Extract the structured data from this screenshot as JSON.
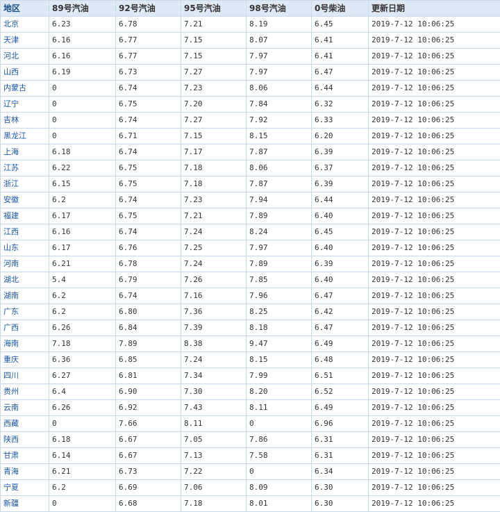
{
  "table": {
    "headers": [
      "地区",
      "89号汽油",
      "92号汽油",
      "95号汽油",
      "98号汽油",
      "0号柴油",
      "更新日期"
    ],
    "rows": [
      [
        "北京",
        "6.23",
        "6.78",
        "7.21",
        "8.19",
        "6.45",
        "2019-7-12  10:06:25"
      ],
      [
        "天津",
        "6.16",
        "6.77",
        "7.15",
        "8.07",
        "6.41",
        "2019-7-12  10:06:25"
      ],
      [
        "河北",
        "6.16",
        "6.77",
        "7.15",
        "7.97",
        "6.41",
        "2019-7-12  10:06:25"
      ],
      [
        "山西",
        "6.19",
        "6.73",
        "7.27",
        "7.97",
        "6.47",
        "2019-7-12  10:06:25"
      ],
      [
        "内蒙古",
        "0",
        "6.74",
        "7.23",
        "8.06",
        "6.44",
        "2019-7-12  10:06:25"
      ],
      [
        "辽宁",
        "0",
        "6.75",
        "7.20",
        "7.84",
        "6.32",
        "2019-7-12  10:06:25"
      ],
      [
        "吉林",
        "0",
        "6.74",
        "7.27",
        "7.92",
        "6.33",
        "2019-7-12  10:06:25"
      ],
      [
        "黑龙江",
        "0",
        "6.71",
        "7.15",
        "8.15",
        "6.20",
        "2019-7-12  10:06:25"
      ],
      [
        "上海",
        "6.18",
        "6.74",
        "7.17",
        "7.87",
        "6.39",
        "2019-7-12  10:06:25"
      ],
      [
        "江苏",
        "6.22",
        "6.75",
        "7.18",
        "8.06",
        "6.37",
        "2019-7-12  10:06:25"
      ],
      [
        "浙江",
        "6.15",
        "6.75",
        "7.18",
        "7.87",
        "6.39",
        "2019-7-12  10:06:25"
      ],
      [
        "安徽",
        "6.2",
        "6.74",
        "7.23",
        "7.94",
        "6.44",
        "2019-7-12  10:06:25"
      ],
      [
        "福建",
        "6.17",
        "6.75",
        "7.21",
        "7.89",
        "6.40",
        "2019-7-12  10:06:25"
      ],
      [
        "江西",
        "6.16",
        "6.74",
        "7.24",
        "8.24",
        "6.45",
        "2019-7-12  10:06:25"
      ],
      [
        "山东",
        "6.17",
        "6.76",
        "7.25",
        "7.97",
        "6.40",
        "2019-7-12  10:06:25"
      ],
      [
        "河南",
        "6.21",
        "6.78",
        "7.24",
        "7.89",
        "6.39",
        "2019-7-12  10:06:25"
      ],
      [
        "湖北",
        "5.4",
        "6.79",
        "7.26",
        "7.85",
        "6.40",
        "2019-7-12  10:06:25"
      ],
      [
        "湖南",
        "6.2",
        "6.74",
        "7.16",
        "7.96",
        "6.47",
        "2019-7-12  10:06:25"
      ],
      [
        "广东",
        "6.2",
        "6.80",
        "7.36",
        "8.25",
        "6.42",
        "2019-7-12  10:06:25"
      ],
      [
        "广西",
        "6.26",
        "6.84",
        "7.39",
        "8.18",
        "6.47",
        "2019-7-12  10:06:25"
      ],
      [
        "海南",
        "7.18",
        "7.89",
        "8.38",
        "9.47",
        "6.49",
        "2019-7-12  10:06:25"
      ],
      [
        "重庆",
        "6.36",
        "6.85",
        "7.24",
        "8.15",
        "6.48",
        "2019-7-12  10:06:25"
      ],
      [
        "四川",
        "6.27",
        "6.81",
        "7.34",
        "7.99",
        "6.51",
        "2019-7-12  10:06:25"
      ],
      [
        "贵州",
        "6.4",
        "6.90",
        "7.30",
        "8.20",
        "6.52",
        "2019-7-12  10:06:25"
      ],
      [
        "云南",
        "6.26",
        "6.92",
        "7.43",
        "8.11",
        "6.49",
        "2019-7-12  10:06:25"
      ],
      [
        "西藏",
        "0",
        "7.66",
        "8.11",
        "0",
        "6.96",
        "2019-7-12  10:06:25"
      ],
      [
        "陕西",
        "6.18",
        "6.67",
        "7.05",
        "7.86",
        "6.31",
        "2019-7-12  10:06:25"
      ],
      [
        "甘肃",
        "6.14",
        "6.67",
        "7.13",
        "7.58",
        "6.31",
        "2019-7-12  10:06:25"
      ],
      [
        "青海",
        "6.21",
        "6.73",
        "7.22",
        "0",
        "6.34",
        "2019-7-12  10:06:25"
      ],
      [
        "宁夏",
        "6.2",
        "6.69",
        "7.06",
        "8.09",
        "6.30",
        "2019-7-12  10:06:25"
      ],
      [
        "新疆",
        "0",
        "6.68",
        "7.18",
        "8.01",
        "6.30",
        "2019-7-12  10:06:25"
      ]
    ]
  },
  "colors": {
    "header_bg": "#dfe9f5",
    "border": "#c9d9ea",
    "region_link": "#1a56a6",
    "text": "#333333"
  }
}
